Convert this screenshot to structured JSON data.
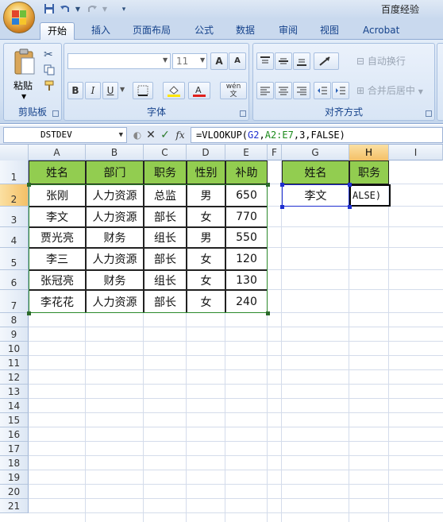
{
  "window": {
    "title": "百度经验"
  },
  "tabs": [
    "开始",
    "插入",
    "页面布局",
    "公式",
    "数据",
    "审阅",
    "视图",
    "Acrobat"
  ],
  "ribbon": {
    "clipboard": {
      "label": "剪贴板",
      "paste_label": "粘贴"
    },
    "font": {
      "label": "字体",
      "font_size": "11",
      "bold": "B",
      "italic": "I",
      "underline": "U",
      "grow": "A",
      "shrink": "A",
      "phonetic": "wén"
    },
    "alignment": {
      "label": "对齐方式",
      "wrap_text": "自动换行",
      "merge_center": "合并后居中"
    }
  },
  "formula_bar": {
    "name_box": "DSTDEV",
    "fx": "fx",
    "formula_parts": [
      {
        "text": "=VLOOKUP(",
        "style": "plain"
      },
      {
        "text": "G2",
        "style": "ref-b"
      },
      {
        "text": ",",
        "style": "plain"
      },
      {
        "text": "A2:E7",
        "style": "ref-g"
      },
      {
        "text": ",3,FALSE)",
        "style": "plain"
      }
    ]
  },
  "sheet": {
    "columns": [
      "A",
      "B",
      "C",
      "D",
      "E",
      "F",
      "G",
      "H",
      "I"
    ],
    "selected_column": "H",
    "rows": [
      "1",
      "2",
      "3",
      "4",
      "5",
      "6",
      "7",
      "8",
      "9",
      "10",
      "11",
      "12",
      "13",
      "14",
      "15",
      "16",
      "17",
      "18",
      "19",
      "20",
      "21"
    ],
    "selected_row": "2",
    "table": {
      "headers": [
        "姓名",
        "部门",
        "职务",
        "性别",
        "补助"
      ],
      "rows": [
        [
          "张刚",
          "人力资源",
          "总监",
          "男",
          "650"
        ],
        [
          "李文",
          "人力资源",
          "部长",
          "女",
          "770"
        ],
        [
          "贾光亮",
          "财务",
          "组长",
          "男",
          "550"
        ],
        [
          "李三",
          "人力资源",
          "部长",
          "女",
          "120"
        ],
        [
          "张冠亮",
          "财务",
          "组长",
          "女",
          "130"
        ],
        [
          "李花花",
          "人力资源",
          "部长",
          "女",
          "240"
        ]
      ]
    },
    "lookup": {
      "headers": [
        "姓名",
        "职务"
      ],
      "g2": "李文",
      "h2_editing": "ALSE)"
    }
  },
  "colors": {
    "header_fill": "#92cd50",
    "selection_orange": "#f4c066",
    "ribbon_blue": "#d3e1f2"
  }
}
